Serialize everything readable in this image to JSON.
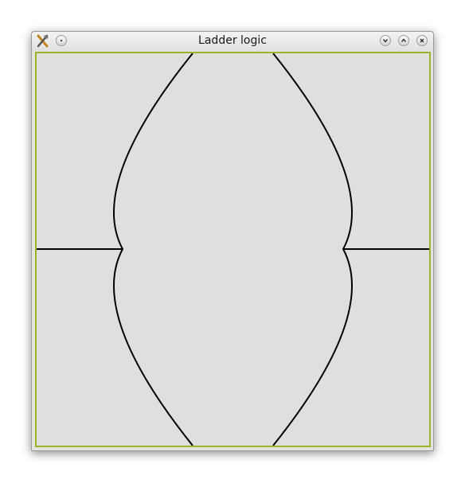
{
  "window": {
    "title": "Ladder logic"
  },
  "titlebar": {
    "app_icon": "tools-icon",
    "menu_button": "menu-dot-icon",
    "minimize_button": "chevron-down-icon",
    "maximize_button": "chevron-up-icon",
    "close_button": "close-icon"
  },
  "colors": {
    "frame_accent": "#9db32b",
    "canvas_bg": "#e0dfde",
    "line": "#000000"
  }
}
